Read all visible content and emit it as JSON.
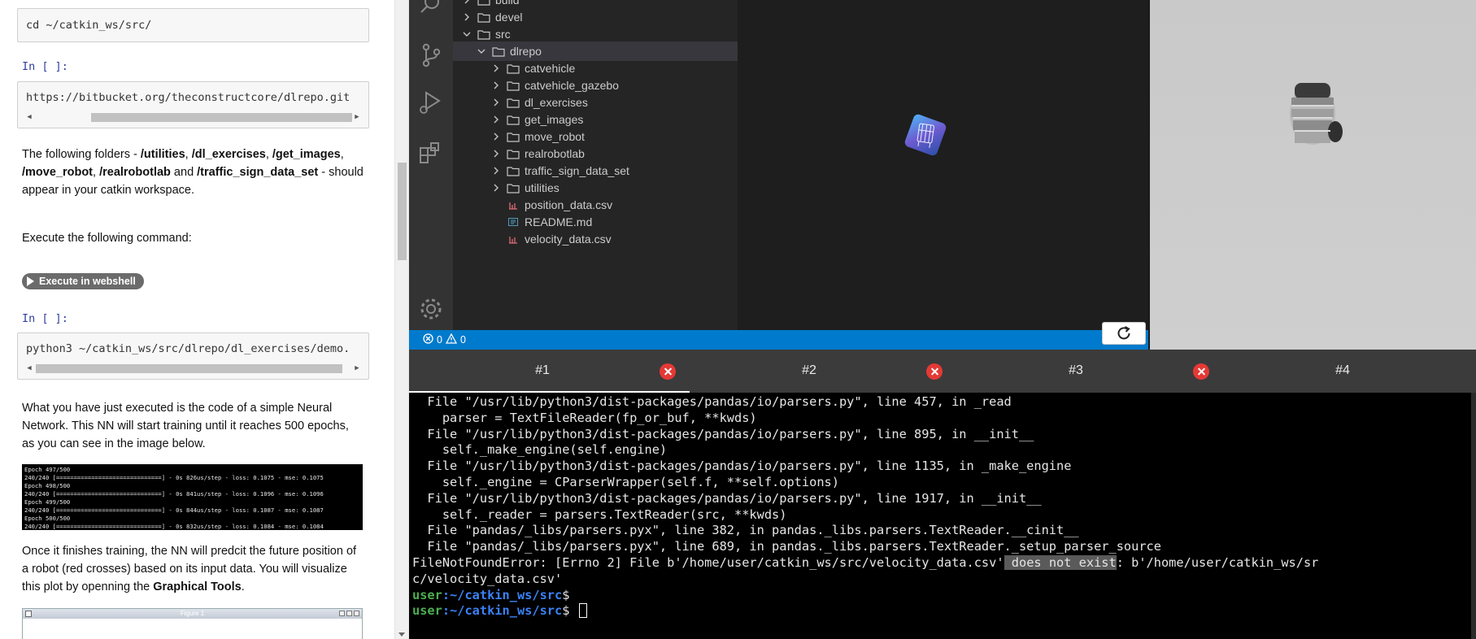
{
  "notebook": {
    "cell1_code": "cd ~/catkin_ws/src/",
    "prompt2": "In [ ]:",
    "cell2_code": "https://bitbucket.org/theconstructcore/dlrepo.git",
    "para1_a": "The following folders - ",
    "para1_f1": "/utilities",
    "para1_f2": "/dl_exercises",
    "para1_f3": "/get_images",
    "para1_f4": "/move_robot",
    "para1_f5": "/realrobotlab",
    "para1_and": " and ",
    "para1_f6": "/traffic_sign_data_set",
    "para1_b": " - should appear in your catkin workspace.",
    "para2": "Execute the following command:",
    "webshell_button": "Execute in webshell",
    "prompt3": "In [ ]:",
    "cell3_code": "python3 ~/catkin_ws/src/dlrepo/dl_exercises/demo.",
    "para3": "What you have just executed is the code of a simple Neural Network. This NN will start training until it reaches 500 epochs, as you can see in the image below.",
    "epoch_log": [
      "Epoch 497/500",
      "240/240 [==============================] - 0s 826us/step - loss: 0.1075 - mse: 0.1075",
      "Epoch 498/500",
      "240/240 [==============================] - 0s 841us/step - loss: 0.1096 - mse: 0.1096",
      "Epoch 499/500",
      "240/240 [==============================] - 0s 844us/step - loss: 0.1087 - mse: 0.1087",
      "Epoch 500/500",
      "240/240 [==============================] - 0s 832us/step - loss: 0.1084 - mse: 0.1084"
    ],
    "para4_a": "Once it finishes training, the NN will predcit the future position of a robot (red crosses) based on its input data. You will visualize this plot by openning the ",
    "para4_bold": "Graphical Tools",
    "para4_b": ".",
    "figure_title": "Figure 1"
  },
  "explorer": {
    "items": [
      {
        "label": "build",
        "type": "folder",
        "depth": 0,
        "expanded": false
      },
      {
        "label": "devel",
        "type": "folder",
        "depth": 0,
        "expanded": false
      },
      {
        "label": "src",
        "type": "folder",
        "depth": 0,
        "expanded": true
      },
      {
        "label": "dlrepo",
        "type": "folder",
        "depth": 1,
        "expanded": true,
        "selected": true
      },
      {
        "label": "catvehicle",
        "type": "folder",
        "depth": 2,
        "expanded": false
      },
      {
        "label": "catvehicle_gazebo",
        "type": "folder",
        "depth": 2,
        "expanded": false
      },
      {
        "label": "dl_exercises",
        "type": "folder",
        "depth": 2,
        "expanded": false
      },
      {
        "label": "get_images",
        "type": "folder",
        "depth": 2,
        "expanded": false
      },
      {
        "label": "move_robot",
        "type": "folder",
        "depth": 2,
        "expanded": false
      },
      {
        "label": "realrobotlab",
        "type": "folder",
        "depth": 2,
        "expanded": false
      },
      {
        "label": "traffic_sign_data_set",
        "type": "folder",
        "depth": 2,
        "expanded": false
      },
      {
        "label": "utilities",
        "type": "folder",
        "depth": 2,
        "expanded": false
      },
      {
        "label": "position_data.csv",
        "type": "csv",
        "depth": 2
      },
      {
        "label": "README.md",
        "type": "md",
        "depth": 2
      },
      {
        "label": "velocity_data.csv",
        "type": "csv",
        "depth": 2
      }
    ]
  },
  "statusbar": {
    "errors": "0",
    "warnings": "0"
  },
  "terminal_tabs": [
    {
      "label": "#1",
      "active": true,
      "closable": true
    },
    {
      "label": "#2",
      "active": false,
      "closable": true
    },
    {
      "label": "#3",
      "active": false,
      "closable": true
    },
    {
      "label": "#4",
      "active": false,
      "closable": false
    }
  ],
  "terminal": {
    "lines": [
      "  File \"/usr/lib/python3/dist-packages/pandas/io/parsers.py\", line 457, in _read",
      "    parser = TextFileReader(fp_or_buf, **kwds)",
      "  File \"/usr/lib/python3/dist-packages/pandas/io/parsers.py\", line 895, in __init__",
      "    self._make_engine(self.engine)",
      "  File \"/usr/lib/python3/dist-packages/pandas/io/parsers.py\", line 1135, in _make_engine",
      "    self._engine = CParserWrapper(self.f, **self.options)",
      "  File \"/usr/lib/python3/dist-packages/pandas/io/parsers.py\", line 1917, in __init__",
      "    self._reader = parsers.TextReader(src, **kwds)",
      "  File \"pandas/_libs/parsers.pyx\", line 382, in pandas._libs.parsers.TextReader.__cinit__",
      "  File \"pandas/_libs/parsers.pyx\", line 689, in pandas._libs.parsers.TextReader._setup_parser_source"
    ],
    "error_pre": "FileNotFoundError: [Errno 2] File b'/home/user/catkin_ws/src/velocity_data.csv'",
    "error_hl": " does not exist",
    "error_post": ": b'/home/user/catkin_ws/sr",
    "error_wrap": "c/velocity_data.csv'",
    "prompt_user": "user",
    "prompt_path": ":~/catkin_ws/src",
    "prompt_sym": "$"
  },
  "colors": {
    "activity_bar": "#333333",
    "explorer_bg": "#252526",
    "statusbar": "#007acc",
    "tab_close": "#e53935",
    "prompt_user": "#4caf50",
    "prompt_path": "#3b82f6"
  }
}
